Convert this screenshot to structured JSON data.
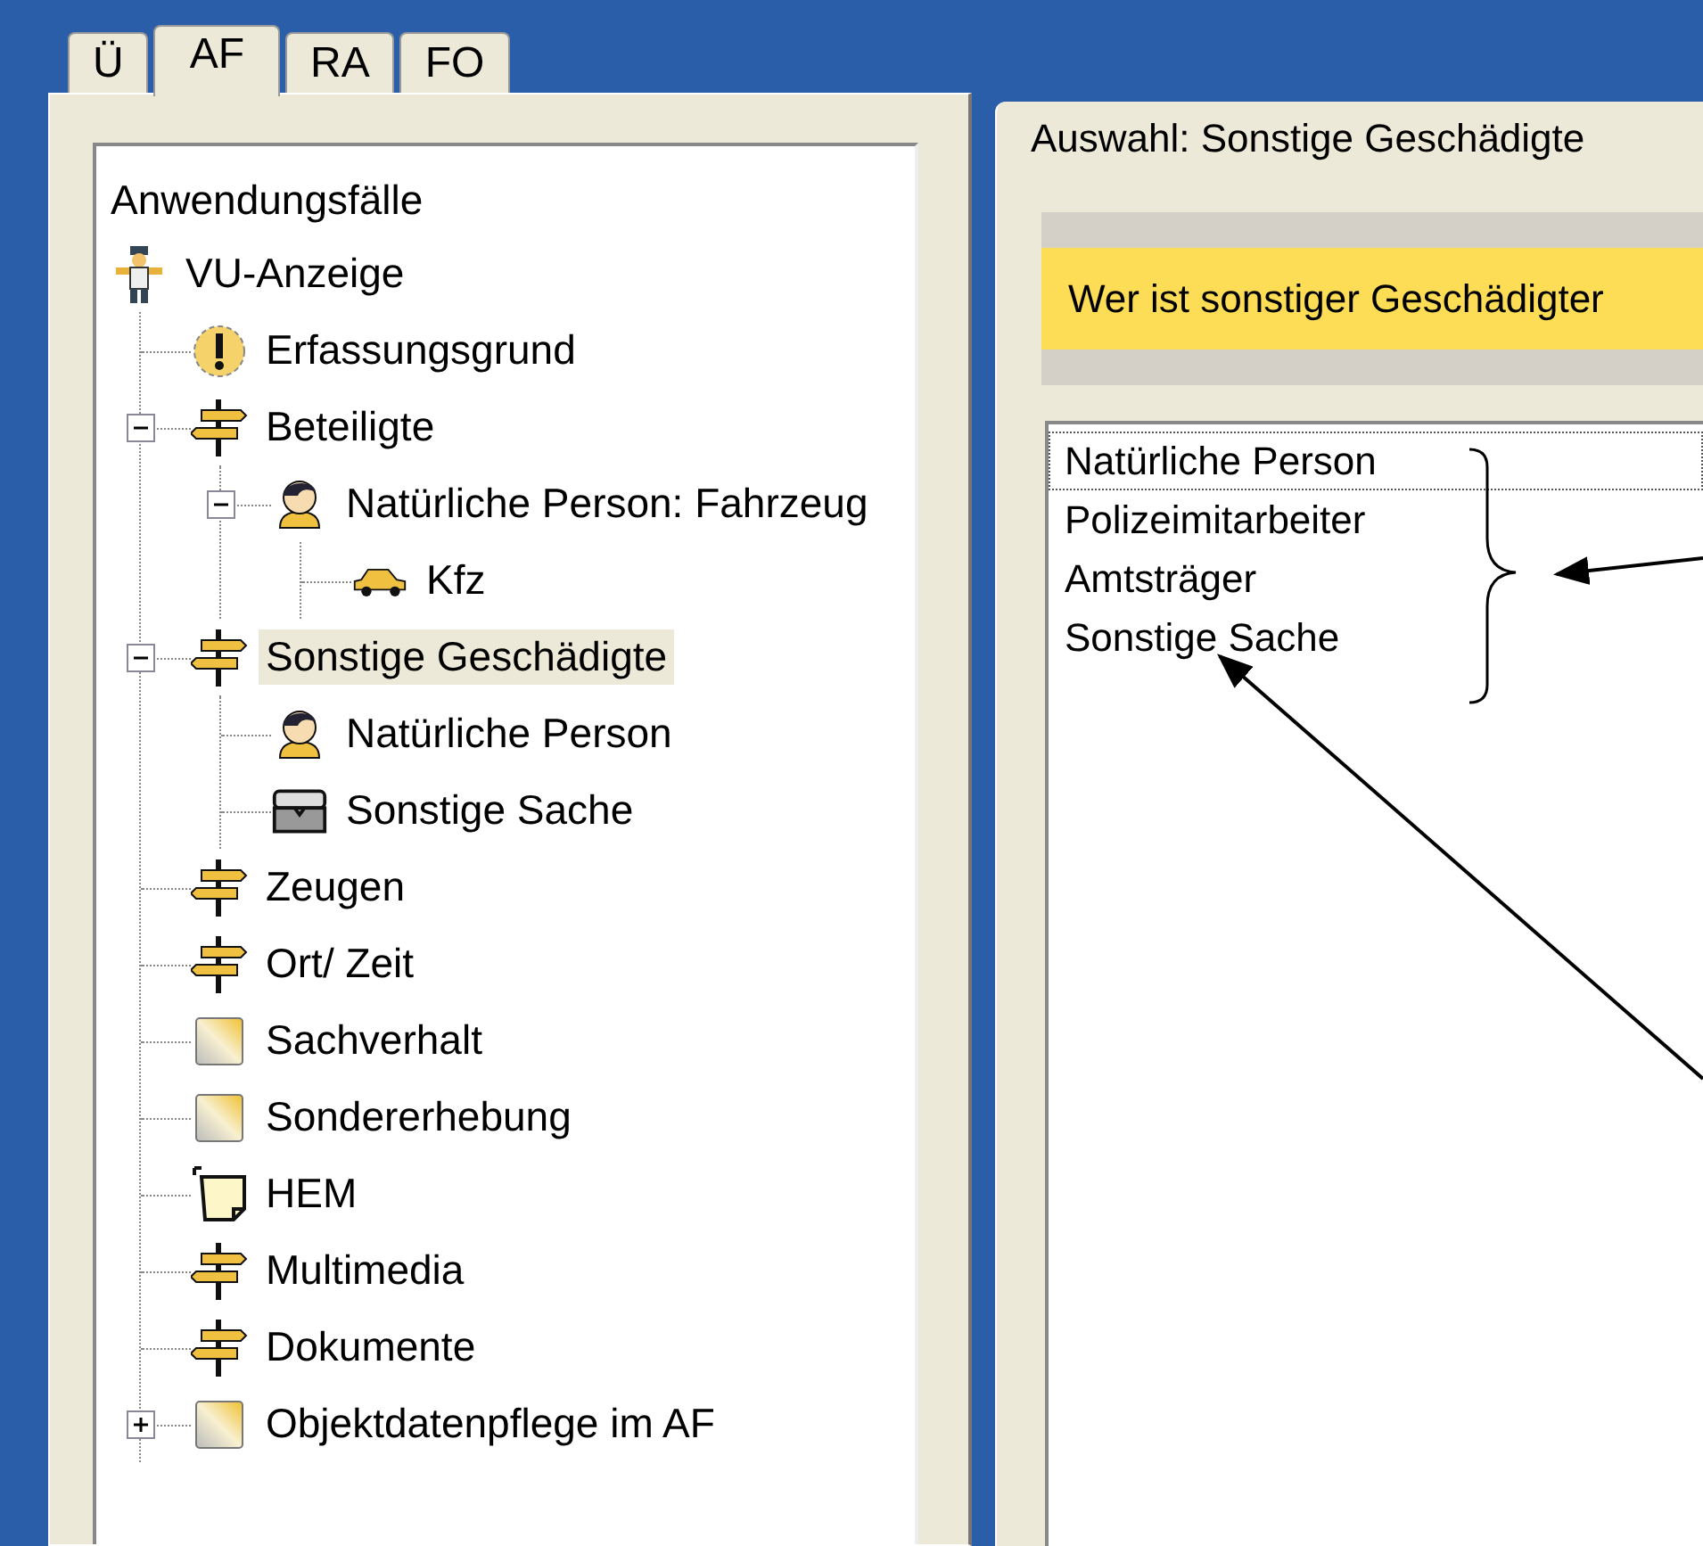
{
  "tabs": [
    {
      "label": "Ü",
      "selected": false
    },
    {
      "label": "AF",
      "selected": true
    },
    {
      "label": "RA",
      "selected": false
    },
    {
      "label": "FO",
      "selected": false
    }
  ],
  "tree": {
    "heading": "Anwendungsfälle",
    "nodes": [
      {
        "label": "VU-Anzeige",
        "kind": "figure",
        "selected": false,
        "children": [
          {
            "label": "Erfassungsgrund",
            "kind": "alert",
            "selected": false
          },
          {
            "label": "Beteiligte",
            "kind": "signpost",
            "selected": false,
            "expanded": true,
            "children": [
              {
                "label": "Natürliche Person: Fahrzeug",
                "kind": "person",
                "selected": false,
                "expanded": true,
                "children": [
                  {
                    "label": "Kfz",
                    "kind": "car",
                    "selected": false
                  }
                ]
              }
            ]
          },
          {
            "label": "Sonstige Geschädigte",
            "kind": "signpost",
            "selected": true,
            "expanded": true,
            "children": [
              {
                "label": "Natürliche Person",
                "kind": "person",
                "selected": false
              },
              {
                "label": "Sonstige Sache",
                "kind": "chest",
                "selected": false
              }
            ]
          },
          {
            "label": "Zeugen",
            "kind": "signpost",
            "selected": false
          },
          {
            "label": "Ort/ Zeit",
            "kind": "signpost",
            "selected": false
          },
          {
            "label": "Sachverhalt",
            "kind": "tile",
            "selected": false
          },
          {
            "label": "Sondererhebung",
            "kind": "tile",
            "selected": false
          },
          {
            "label": "HEM",
            "kind": "note",
            "selected": false
          },
          {
            "label": "Multimedia",
            "kind": "signpost",
            "selected": false
          },
          {
            "label": "Dokumente",
            "kind": "signpost",
            "selected": false
          },
          {
            "label": "Objektdatenpflege im AF",
            "kind": "tile",
            "selected": false,
            "expanded": false
          }
        ]
      }
    ]
  },
  "panel": {
    "title": "Auswahl: Sonstige Geschädigte",
    "question": "Wer ist sonstiger Geschädigter",
    "options": [
      {
        "label": "Natürliche Person",
        "selected": true
      },
      {
        "label": "Polizeimitarbeiter",
        "selected": false
      },
      {
        "label": "Amtsträger",
        "selected": false
      },
      {
        "label": "Sonstige Sache",
        "selected": false
      }
    ]
  }
}
